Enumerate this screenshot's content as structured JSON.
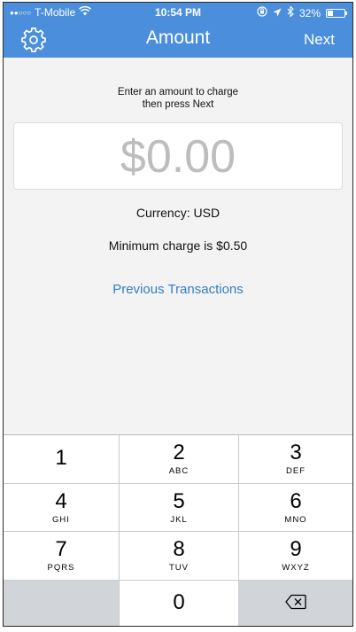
{
  "status_bar": {
    "carrier": "T-Mobile",
    "time": "10:54 PM",
    "battery": "32%",
    "battery_level": 0.32
  },
  "nav": {
    "title": "Amount",
    "next_label": "Next",
    "settings_icon": "gear-icon"
  },
  "instruction": {
    "line1": "Enter an amount to charge",
    "line2": "then press Next"
  },
  "amount": {
    "value": "$0.00"
  },
  "currency_text": "Currency: USD",
  "minimum_text": "Minimum charge is $0.50",
  "previous_transactions": "Previous Transactions",
  "keypad": {
    "keys": [
      {
        "num": "1",
        "letters": ""
      },
      {
        "num": "2",
        "letters": "ABC"
      },
      {
        "num": "3",
        "letters": "DEF"
      },
      {
        "num": "4",
        "letters": "GHI"
      },
      {
        "num": "5",
        "letters": "JKL"
      },
      {
        "num": "6",
        "letters": "MNO"
      },
      {
        "num": "7",
        "letters": "PQRS"
      },
      {
        "num": "8",
        "letters": "TUV"
      },
      {
        "num": "9",
        "letters": "WXYZ"
      },
      {
        "num": "0",
        "letters": ""
      }
    ],
    "delete_icon": "backspace-icon"
  },
  "colors": {
    "accent": "#4b8fdc",
    "link": "#2f7fc8",
    "placeholder": "#bdbdbd"
  }
}
